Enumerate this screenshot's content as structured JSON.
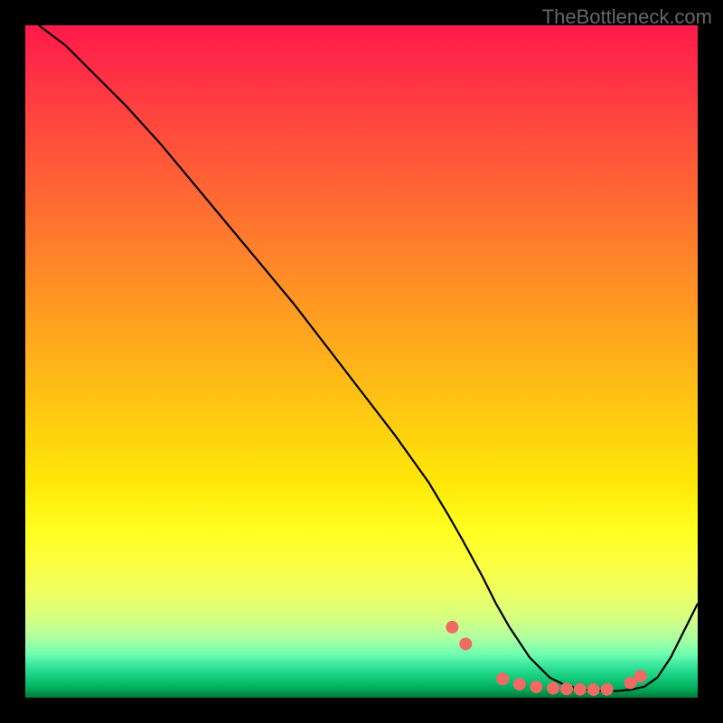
{
  "attribution": "TheBottleneck.com",
  "chart_data": {
    "type": "line",
    "title": "",
    "xlabel": "",
    "ylabel": "",
    "xlim": [
      0,
      100
    ],
    "ylim": [
      0,
      100
    ],
    "curve": {
      "x": [
        2,
        6,
        10,
        15,
        20,
        25,
        30,
        35,
        40,
        45,
        50,
        55,
        60,
        63,
        65,
        68,
        70,
        72,
        75,
        78,
        80,
        82,
        84,
        86,
        88,
        90,
        92,
        94,
        96,
        98,
        100
      ],
      "y": [
        100,
        97,
        93,
        88,
        82.5,
        76.5,
        70.5,
        64.5,
        58.5,
        52,
        45.5,
        39,
        32,
        27,
        23.5,
        18,
        14,
        10.5,
        6,
        3,
        2,
        1.4,
        1.1,
        1,
        1,
        1.2,
        1.6,
        3,
        6,
        10,
        14
      ]
    },
    "dots": {
      "x": [
        63.5,
        65.5,
        71,
        73.5,
        76,
        78.5,
        80.5,
        82.5,
        84.5,
        86.5,
        90,
        91.5
      ],
      "y": [
        10.5,
        8,
        2.8,
        2,
        1.6,
        1.4,
        1.3,
        1.25,
        1.2,
        1.25,
        2.2,
        3.2
      ]
    },
    "gradient_stops": [
      {
        "pos": 0,
        "color": "#ff1a4a"
      },
      {
        "pos": 75,
        "color": "#ffff20"
      },
      {
        "pos": 100,
        "color": "#007838"
      }
    ]
  }
}
